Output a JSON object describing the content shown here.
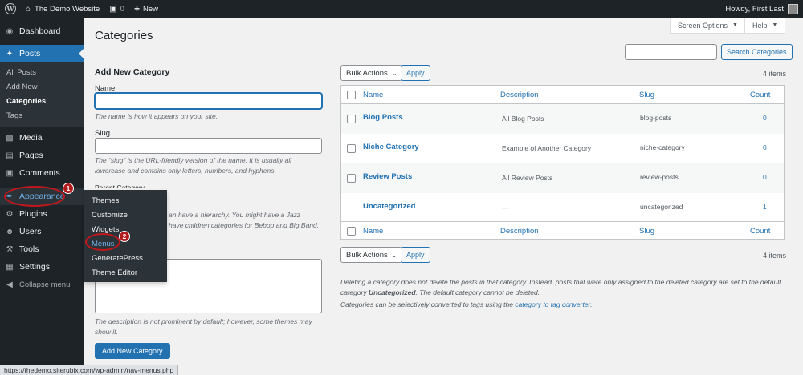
{
  "adminbar": {
    "site_name": "The Demo Website",
    "comments_count": "0",
    "new_label": "New",
    "howdy": "Howdy, First Last"
  },
  "sidebar": {
    "dashboard": "Dashboard",
    "posts": "Posts",
    "posts_sub": [
      "All Posts",
      "Add New",
      "Categories",
      "Tags"
    ],
    "media": "Media",
    "pages": "Pages",
    "comments": "Comments",
    "appearance": "Appearance",
    "plugins": "Plugins",
    "users": "Users",
    "tools": "Tools",
    "settings": "Settings",
    "collapse": "Collapse menu"
  },
  "flyout": [
    "Themes",
    "Customize",
    "Widgets",
    "Menus",
    "GeneratePress",
    "Theme Editor"
  ],
  "annotations": {
    "badge1": "1",
    "badge2": "2",
    "ring_color": "#c4161c"
  },
  "main": {
    "title": "Categories",
    "screen_options": "Screen Options",
    "help": "Help",
    "form": {
      "heading": "Add New Category",
      "name_label": "Name",
      "name_help": "The name is how it appears on your site.",
      "slug_label": "Slug",
      "slug_help": "The “slug” is the URL-friendly version of the name. It is usually all lowercase and contains only letters, numbers, and hyphens.",
      "parent_label_partial": "Parent Category",
      "parent_help_partial_1": "an have a hierarchy. You might have a Jazz",
      "parent_help_partial_2": "have children categories for Bebop and Big Band.",
      "description_help": "The description is not prominent by default; however, some themes may show it.",
      "submit": "Add New Category"
    },
    "search_button": "Search Categories",
    "bulk_actions": "Bulk Actions",
    "apply": "Apply",
    "items_count": "4 items",
    "columns": {
      "name": "Name",
      "description": "Description",
      "slug": "Slug",
      "count": "Count"
    },
    "rows": [
      {
        "name": "Blog Posts",
        "description": "All Blog Posts",
        "slug": "blog-posts",
        "count": "0"
      },
      {
        "name": "Niche Category",
        "description": "Example of Another Category",
        "slug": "niche-category",
        "count": "0"
      },
      {
        "name": "Review Posts",
        "description": "All Review Posts",
        "slug": "review-posts",
        "count": "0"
      },
      {
        "name": "Uncategorized",
        "description": "—",
        "slug": "uncategorized",
        "count": "1"
      }
    ],
    "note_1a": "Deleting a category does not delete the posts in that category. Instead, posts that were only assigned to the deleted category are set to the default category ",
    "note_1b": "Uncategorized",
    "note_1c": ". The default category cannot be deleted.",
    "note_2a": "Categories can be selectively converted to tags using the ",
    "note_2b": "category to tag converter",
    "note_2c": "."
  },
  "statusbar": {
    "url": "https://thedemo.siterubix.com/wp-admin/nav-menus.php"
  },
  "colors": {
    "accent": "#2271b1",
    "sidebar": "#1d2327",
    "annotation": "#c4161c"
  }
}
